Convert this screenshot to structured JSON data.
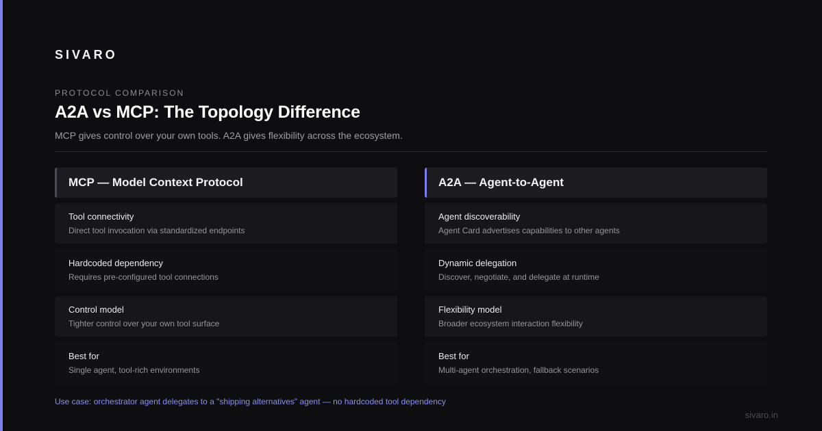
{
  "brand": "SIVARO",
  "eyebrow": "PROTOCOL COMPARISON",
  "title": "A2A vs MCP: The Topology Difference",
  "subtitle": "MCP gives control over your own tools. A2A gives flexibility across the ecosystem.",
  "colors": {
    "accent": "#7b7ff0",
    "background": "#0e0e10"
  },
  "columns": [
    {
      "header": "MCP — Model Context Protocol",
      "rows": [
        {
          "title": "Tool connectivity",
          "desc": "Direct tool invocation via standardized endpoints"
        },
        {
          "title": "Hardcoded dependency",
          "desc": "Requires pre-configured tool connections"
        },
        {
          "title": "Control model",
          "desc": "Tighter control over your own tool surface"
        },
        {
          "title": "Best for",
          "desc": "Single agent, tool-rich environments"
        }
      ]
    },
    {
      "header": "A2A — Agent-to-Agent",
      "rows": [
        {
          "title": "Agent discoverability",
          "desc": "Agent Card advertises capabilities to other agents"
        },
        {
          "title": "Dynamic delegation",
          "desc": "Discover, negotiate, and delegate at runtime"
        },
        {
          "title": "Flexibility model",
          "desc": "Broader ecosystem interaction flexibility"
        },
        {
          "title": "Best for",
          "desc": "Multi-agent orchestration, fallback scenarios"
        }
      ]
    }
  ],
  "footnote": "Use case: orchestrator agent delegates to a \"shipping alternatives\" agent — no hardcoded tool dependency",
  "site": "sivaro.in"
}
